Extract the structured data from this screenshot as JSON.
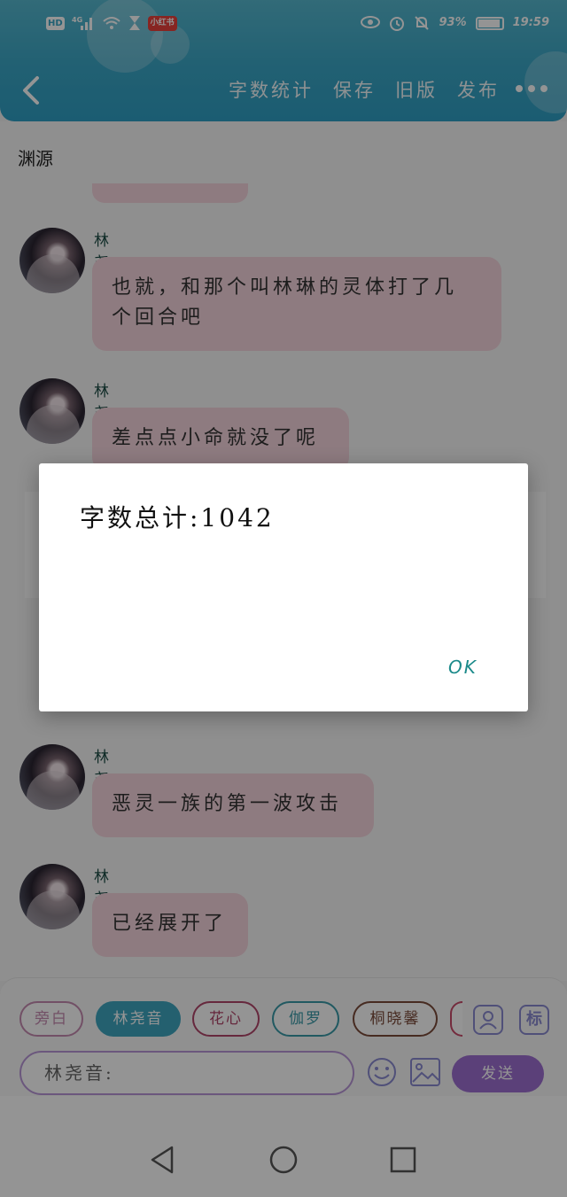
{
  "status_bar": {
    "hd": "HD",
    "network": "4G",
    "battery_pct": "93%",
    "time": "19:59",
    "app_badge": "小红书"
  },
  "toolbar": {
    "items": [
      "字数统计",
      "保存",
      "旧版",
      "发布"
    ]
  },
  "chat": {
    "narration": "渊源",
    "messages": [
      {
        "sender": "林尧音",
        "text": "也就，和那个叫林琳的灵体打了几\n个回合吧"
      },
      {
        "sender": "林尧音",
        "text": "差点点小命就没了呢"
      },
      {
        "sender": "林尧音",
        "text": "恶灵一族的第一波攻击"
      },
      {
        "sender": "林尧音",
        "text": "已经展开了"
      }
    ]
  },
  "panel": {
    "chips": [
      {
        "label": "旁白",
        "color": "#c58ab0"
      },
      {
        "label": "林尧音",
        "color": "#3fa6c0"
      },
      {
        "label": "花心",
        "color": "#b0456a"
      },
      {
        "label": "伽罗",
        "color": "#3a9aa8"
      },
      {
        "label": "桐晓馨",
        "color": "#7a4a3a"
      }
    ],
    "selected_chip": "林尧音",
    "mark_label": "标",
    "input_value": "林尧音:",
    "send_label": "发送"
  },
  "dialog": {
    "message": "字数总计:1042",
    "ok_label": "OK"
  },
  "colors": {
    "header": "#3aa6c6",
    "bubble": "#f4d4dc",
    "send": "#9d6fd0",
    "ok": "#1b8a8a"
  }
}
